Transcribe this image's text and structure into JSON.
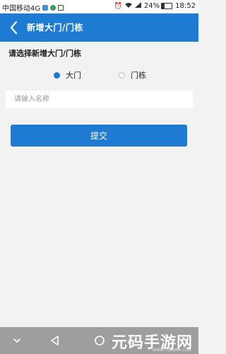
{
  "status_bar": {
    "carrier": "中国移动4G",
    "battery": "24%",
    "battery_level": 0.24,
    "time": "18:52",
    "icons": [
      "sim-signal-icon",
      "app-icon",
      "image-icon",
      "alarm-icon",
      "wifi-icon",
      "signal-icon",
      "battery-icon"
    ]
  },
  "header": {
    "back_icon": "chevron-left-icon",
    "title": "新增大门/门栋"
  },
  "form": {
    "section_label": "请选择新增大门/门栋",
    "options": [
      {
        "label": "大门",
        "selected": true
      },
      {
        "label": "门栋",
        "selected": false
      }
    ],
    "name_input": {
      "value": "",
      "placeholder": "请输入名称"
    },
    "submit_label": "提交"
  },
  "nav_bar": {
    "buttons": [
      "collapse-icon",
      "back-triangle-icon",
      "home-circle-icon"
    ],
    "watermark": "元码手游网",
    "watermark_sub": "WWW.YUANMA.COM"
  },
  "colors": {
    "primary": "#1f7ad2",
    "background": "#f2f2f2",
    "navbar": "#9e9e9e"
  }
}
